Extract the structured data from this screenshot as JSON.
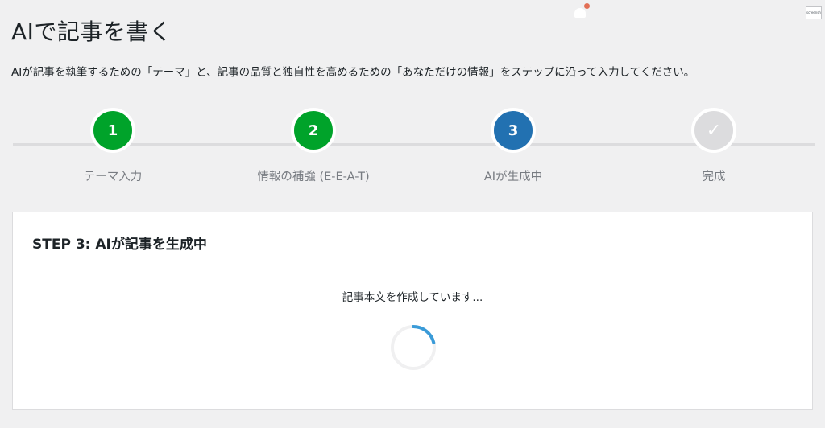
{
  "header": {
    "title": "AIで記事を書く",
    "description": "AIが記事を執筆するための「テーマ」と、記事の品質と独自性を高めるための「あなただけの情報」をステップに沿って入力してください。",
    "top_thumb_label": "screenshot"
  },
  "steps": [
    {
      "marker": "1",
      "label": "テーマ入力",
      "state": "done"
    },
    {
      "marker": "2",
      "label": "情報の補強 (E-E-A-T)",
      "state": "done"
    },
    {
      "marker": "3",
      "label": "AIが生成中",
      "state": "active"
    },
    {
      "marker": "✓",
      "label": "完成",
      "state": "pending"
    }
  ],
  "card": {
    "title": "STEP 3: AIが記事を生成中",
    "status": "記事本文を作成しています..."
  },
  "colors": {
    "done": "#00a32a",
    "active": "#2271b1",
    "pending": "#dcdcde",
    "spinner_accent": "#3a9bd8",
    "spinner_track": "#f0f0f1"
  },
  "icons": {
    "notification": "bell-icon",
    "check": "checkmark-icon",
    "spinner": "loading-spinner-icon"
  }
}
